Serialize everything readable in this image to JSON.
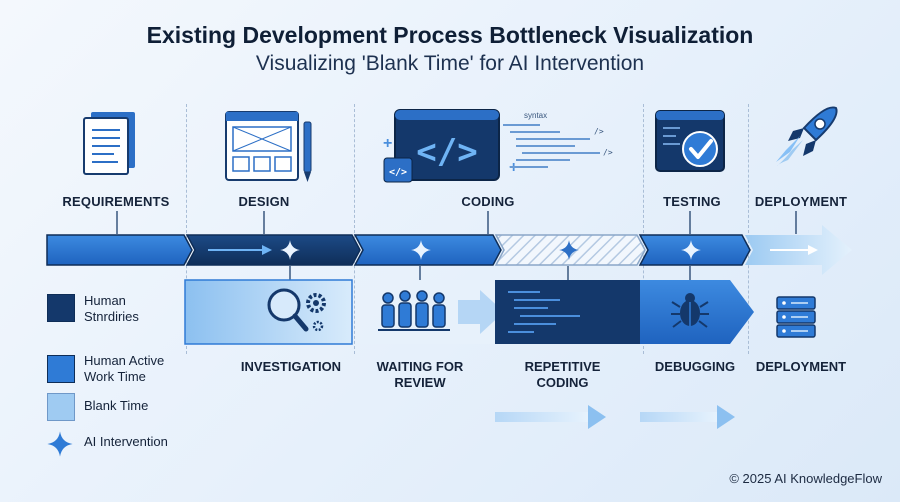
{
  "header": {
    "title": "Existing Development Process Bottleneck Visualization",
    "subtitle": "Visualizing 'Blank Time' for AI Intervention"
  },
  "stages": [
    {
      "label": "REQUIREMENTS",
      "icon": "document-stack-icon"
    },
    {
      "label": "DESIGN",
      "icon": "wireframe-pencil-icon"
    },
    {
      "label": "CODING",
      "icon": "code-window-icon"
    },
    {
      "label": "TESTING",
      "icon": "checkmark-monitor-icon"
    },
    {
      "label": "DEPLOYMENT",
      "icon": "rocket-icon"
    }
  ],
  "coding_snippet": {
    "label": "syntax",
    "tags": [
      "/>",
      "/>"
    ]
  },
  "tasks": [
    {
      "label": "INVESTIGATION",
      "icon": "magnifier-gear-icon"
    },
    {
      "label": "WAITING FOR REVIEW",
      "icon": "people-group-icon"
    },
    {
      "label": "REPETITIVE CODING",
      "icon": "code-lines-icon"
    },
    {
      "label": "DEBUGGING",
      "icon": "bug-icon"
    },
    {
      "label": "DEPLOYMENT",
      "icon": "server-icon"
    }
  ],
  "legend": [
    {
      "label": "Human Stnrdiries",
      "color": "#14386b"
    },
    {
      "label": "Human Active Work Time",
      "color": "#2f7bd6"
    },
    {
      "label": "Blank Time",
      "color": "#9fcbf2"
    },
    {
      "label": "AI Intervention",
      "icon": "sparkle-icon"
    }
  ],
  "colors": {
    "dark_navy": "#14386b",
    "active_blue": "#2f7bd6",
    "blank_light": "#9fcbf2",
    "sparkle": "#eaf4ff"
  },
  "footer": {
    "copyright": "© 2025 AI KnowledgeFlow"
  }
}
